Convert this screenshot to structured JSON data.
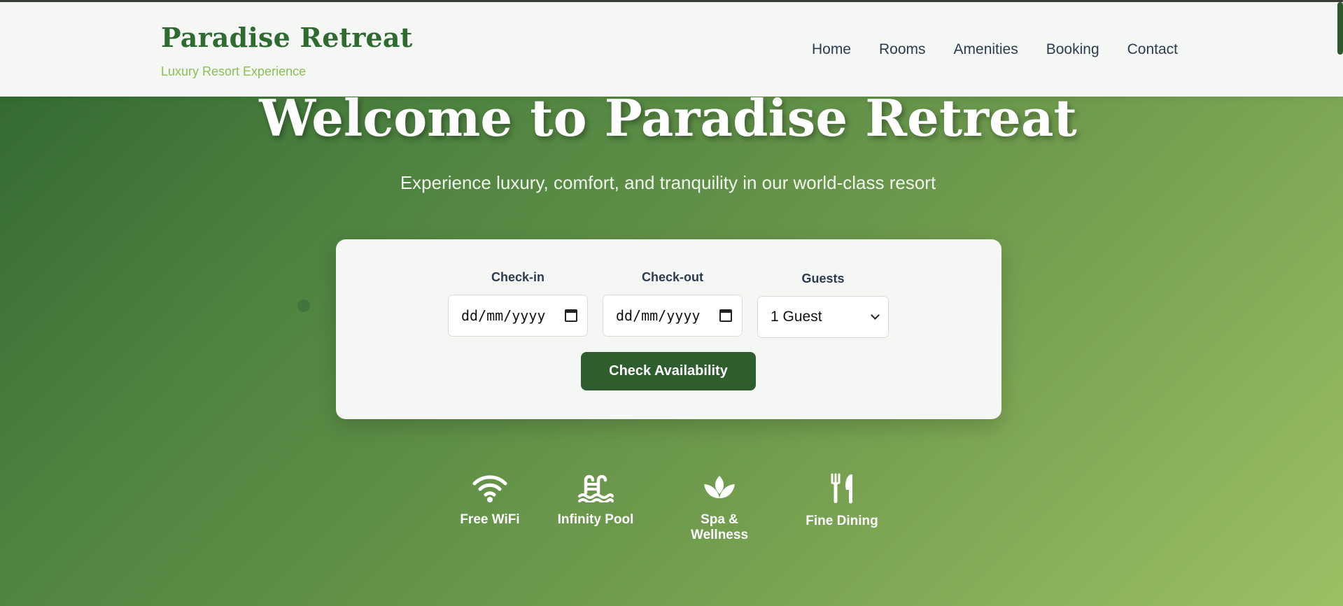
{
  "header": {
    "brand_title": "Paradise Retreat",
    "brand_subtitle": "Luxury Resort Experience",
    "nav": [
      {
        "label": "Home"
      },
      {
        "label": "Rooms"
      },
      {
        "label": "Amenities"
      },
      {
        "label": "Booking"
      },
      {
        "label": "Contact"
      }
    ]
  },
  "hero": {
    "title": "Welcome to Paradise Retreat",
    "subtitle": "Experience luxury, comfort, and tranquility in our world-class resort"
  },
  "booking": {
    "checkin_label": "Check-in",
    "checkin_value": "dd/mm/yyyy",
    "checkout_label": "Check-out",
    "checkout_value": "dd/mm/yyyy",
    "guests_label": "Guests",
    "guests_value": "1 Guest",
    "button_label": "Check Availability"
  },
  "amenities": [
    {
      "label": "Free WiFi",
      "icon": "wifi-icon"
    },
    {
      "label": "Infinity Pool",
      "icon": "pool-icon"
    },
    {
      "label": "Spa & Wellness",
      "icon": "spa-icon"
    },
    {
      "label": "Fine Dining",
      "icon": "dining-icon"
    }
  ],
  "colors": {
    "brand": "#2f6a31",
    "accent": "#8bbf52",
    "button": "#2e5e2d",
    "nav_text": "#2c3c50"
  }
}
